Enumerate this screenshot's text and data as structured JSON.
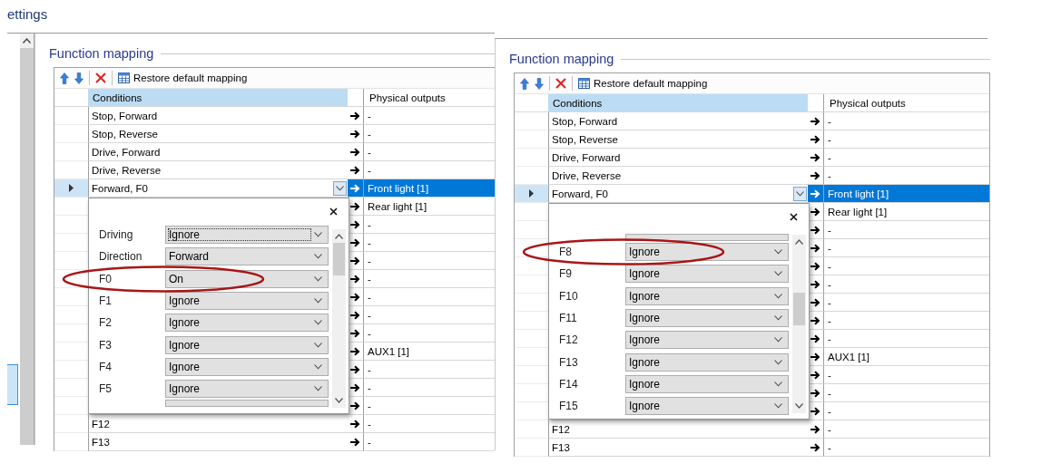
{
  "panels": [
    {
      "page_title": "ettings",
      "sidebar": {
        "items": [
          {
            "selected": true
          }
        ]
      },
      "group_title": "Function mapping",
      "toolbar": {
        "restore_label": "Restore default mapping"
      },
      "columns": [
        "Conditions",
        "Physical outputs"
      ],
      "rows": [
        {
          "condition": "Stop, Forward",
          "output": "-",
          "selected": false
        },
        {
          "condition": "Stop, Reverse",
          "output": "-",
          "selected": false
        },
        {
          "condition": "Drive, Forward",
          "output": "-",
          "selected": false
        },
        {
          "condition": "Drive, Reverse",
          "output": "-",
          "selected": false
        },
        {
          "condition": "Forward, F0",
          "output": "Front light [1]",
          "selected": true
        },
        {
          "output": "Rear light [1]",
          "selected": false
        },
        {
          "output": "-",
          "selected": false
        },
        {
          "output": "-",
          "selected": false
        },
        {
          "output": "-",
          "selected": false
        },
        {
          "output": "-",
          "selected": false
        },
        {
          "output": "-",
          "selected": false
        },
        {
          "output": "-",
          "selected": false
        },
        {
          "output": "-",
          "selected": false
        },
        {
          "output": "AUX1 [1]",
          "selected": false
        },
        {
          "output": "-",
          "selected": false
        },
        {
          "output": "-",
          "selected": false
        },
        {
          "output": "-",
          "selected": false
        },
        {
          "condition": "F12",
          "output": "-",
          "selected": false
        },
        {
          "condition": "F13",
          "output": "-",
          "selected": false
        }
      ],
      "popup": {
        "scrolled": false,
        "rows": [
          {
            "label": "Driving",
            "value": "Ignore",
            "focused": true,
            "circled": false
          },
          {
            "label": "Direction",
            "value": "Forward",
            "focused": false,
            "circled": false
          },
          {
            "label": "F0",
            "value": "On",
            "focused": false,
            "circled": true
          },
          {
            "label": "F1",
            "value": "Ignore",
            "focused": false,
            "circled": false
          },
          {
            "label": "F2",
            "value": "Ignore",
            "focused": false,
            "circled": false
          },
          {
            "label": "F3",
            "value": "Ignore",
            "focused": false,
            "circled": false
          },
          {
            "label": "F4",
            "value": "Ignore",
            "focused": false,
            "circled": false
          },
          {
            "label": "F5",
            "value": "Ignore",
            "focused": false,
            "circled": false
          }
        ]
      }
    },
    {
      "group_title": "Function mapping",
      "toolbar": {
        "restore_label": "Restore default mapping"
      },
      "columns": [
        "Conditions",
        "Physical outputs"
      ],
      "rows": [
        {
          "condition": "Stop, Forward",
          "output": "-",
          "selected": false
        },
        {
          "condition": "Stop, Reverse",
          "output": "-",
          "selected": false
        },
        {
          "condition": "Drive, Forward",
          "output": "-",
          "selected": false
        },
        {
          "condition": "Drive, Reverse",
          "output": "-",
          "selected": false
        },
        {
          "condition": "Forward, F0",
          "output": "Front light [1]",
          "selected": true
        },
        {
          "output": "Rear light [1]",
          "selected": false
        },
        {
          "output": "-",
          "selected": false
        },
        {
          "output": "-",
          "selected": false
        },
        {
          "output": "-",
          "selected": false
        },
        {
          "output": "-",
          "selected": false
        },
        {
          "output": "-",
          "selected": false
        },
        {
          "output": "-",
          "selected": false
        },
        {
          "output": "-",
          "selected": false
        },
        {
          "output": "AUX1 [1]",
          "selected": false
        },
        {
          "output": "-",
          "selected": false
        },
        {
          "output": "-",
          "selected": false
        },
        {
          "output": "-",
          "selected": false
        },
        {
          "condition": "F12",
          "output": "-",
          "selected": false
        },
        {
          "condition": "F13",
          "output": "-",
          "selected": false
        }
      ],
      "popup": {
        "scrolled": true,
        "rows": [
          {
            "label": "F8",
            "value": "Ignore",
            "focused": false,
            "circled": true
          },
          {
            "label": "F9",
            "value": "Ignore",
            "focused": false,
            "circled": false
          },
          {
            "label": "F10",
            "value": "Ignore",
            "focused": false,
            "circled": false
          },
          {
            "label": "F11",
            "value": "Ignore",
            "focused": false,
            "circled": false
          },
          {
            "label": "F12",
            "value": "Ignore",
            "focused": false,
            "circled": false
          },
          {
            "label": "F13",
            "value": "Ignore",
            "focused": false,
            "circled": false
          },
          {
            "label": "F14",
            "value": "Ignore",
            "focused": false,
            "circled": false
          },
          {
            "label": "F15",
            "value": "Ignore",
            "focused": false,
            "circled": false
          }
        ]
      }
    }
  ]
}
